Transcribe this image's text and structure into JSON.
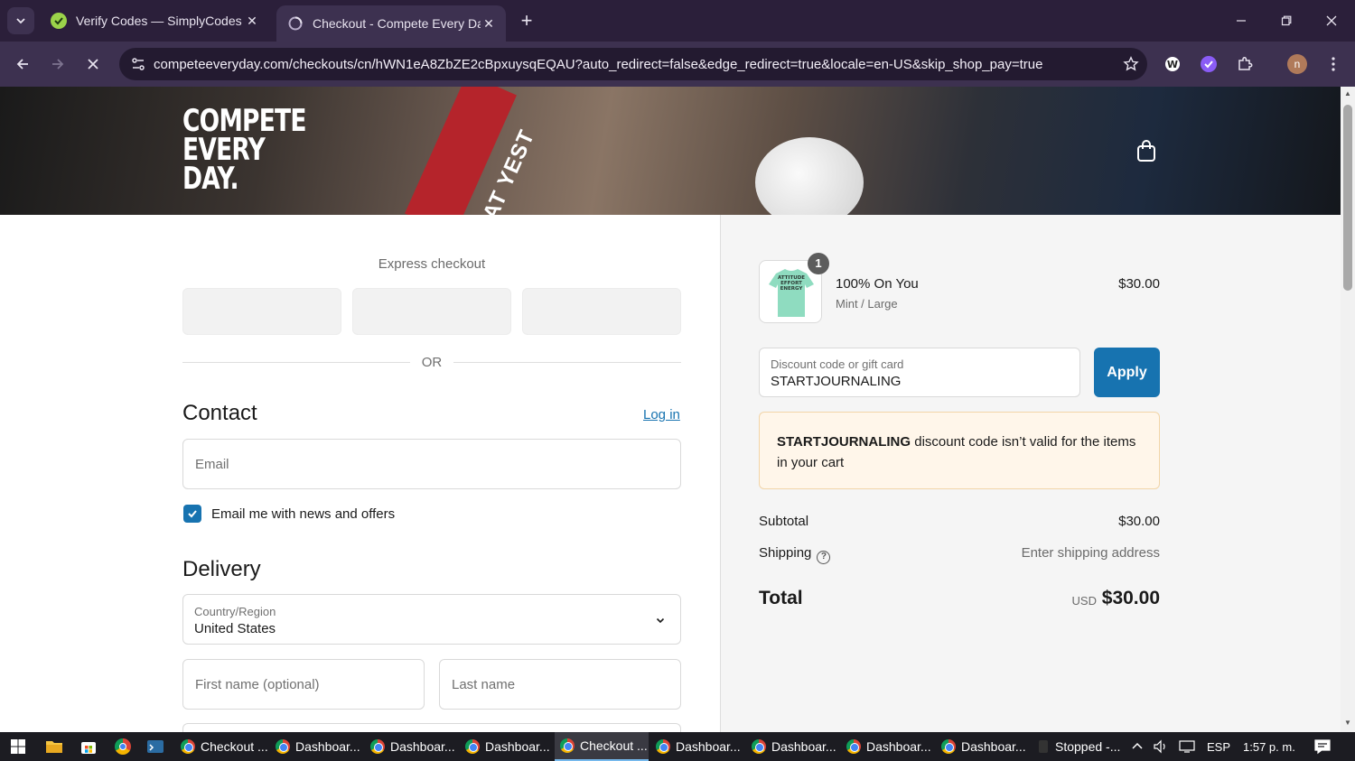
{
  "browser": {
    "tabs": [
      {
        "title": "Verify Codes — SimplyCodes",
        "active": false,
        "favicon": "simplycodes-check-icon"
      },
      {
        "title": "Checkout - Compete Every Day",
        "active": true,
        "favicon": "loading-spinner-icon"
      }
    ],
    "url": "competeeveryday.com/checkouts/cn/hWN1eA8ZbZE2cBpxuysqEQAU?auto_redirect=false&edge_redirect=true&locale=en-US&skip_shop_pay=true",
    "profile_initial": "n"
  },
  "header": {
    "logo_lines": [
      "COMPETE",
      "EVERY",
      "DAY."
    ],
    "band_text": "BEAT YEST"
  },
  "checkout": {
    "express_label": "Express checkout",
    "or_text": "OR",
    "contact_heading": "Contact",
    "login_link": "Log in",
    "email_placeholder": "Email",
    "news_checkbox_label": "Email me with news and offers",
    "news_checked": true,
    "delivery_heading": "Delivery",
    "country_label": "Country/Region",
    "country_value": "United States",
    "first_name_placeholder": "First name (optional)",
    "last_name_placeholder": "Last name"
  },
  "summary": {
    "item": {
      "qty": "1",
      "name": "100% On You",
      "variant": "Mint / Large",
      "price": "$30.00",
      "shirt_print": [
        "ATTITUDE",
        "EFFORT",
        "ENERGY"
      ]
    },
    "discount_label": "Discount code or gift card",
    "discount_value": "STARTJOURNALING",
    "apply_label": "Apply",
    "alert_code": "STARTJOURNALING",
    "alert_message": " discount code isn’t valid for the items in your cart",
    "subtotal_label": "Subtotal",
    "subtotal_value": "$30.00",
    "shipping_label": "Shipping",
    "shipping_value": "Enter shipping address",
    "total_label": "Total",
    "total_currency": "USD",
    "total_value": "$30.00"
  },
  "taskbar": {
    "items": [
      {
        "label": "Checkout ...",
        "active": false
      },
      {
        "label": "Dashboar...",
        "active": false
      },
      {
        "label": "Dashboar...",
        "active": false
      },
      {
        "label": "Dashboar...",
        "active": false
      },
      {
        "label": "Checkout ...",
        "active": true
      },
      {
        "label": "Dashboar...",
        "active": false
      },
      {
        "label": "Dashboar...",
        "active": false
      },
      {
        "label": "Dashboar...",
        "active": false
      },
      {
        "label": "Dashboar...",
        "active": false
      }
    ],
    "stopped_label": "Stopped -...",
    "language": "ESP",
    "time": "1:57 p. m."
  },
  "colors": {
    "accent": "#1773b0",
    "browser_frame": "#2b1f3a",
    "alert_bg": "#fff6ea",
    "shirt": "#8fdcc0"
  }
}
